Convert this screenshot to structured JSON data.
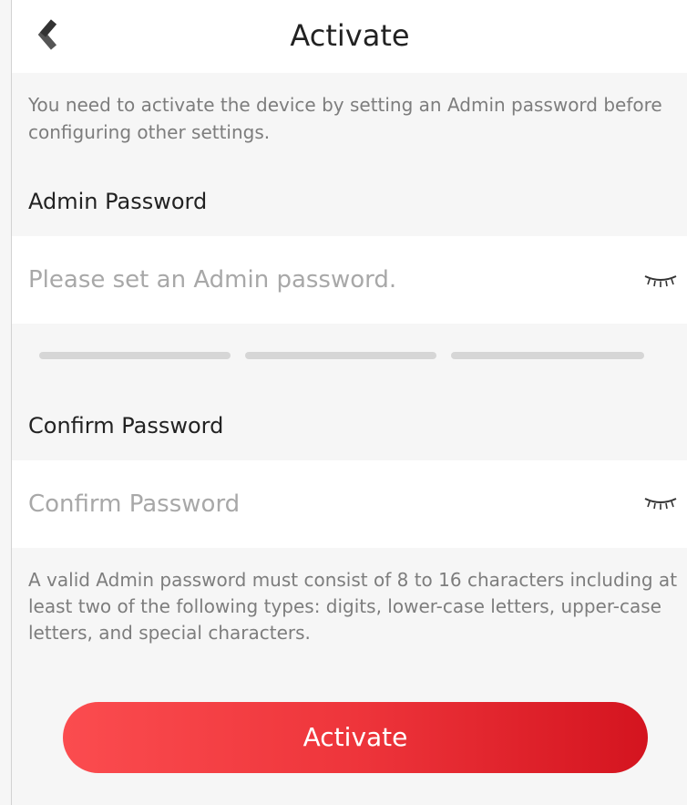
{
  "header": {
    "title": "Activate",
    "back_icon": "chevron-left-icon"
  },
  "intro_text": "You need to activate the device by setting an Admin password before configuring other settings.",
  "admin_password": {
    "label": "Admin Password",
    "value": "",
    "placeholder": "Please set an Admin password.",
    "visibility_icon": "eye-closed-icon"
  },
  "strength_meter": {
    "segments": 3,
    "filled": 0
  },
  "confirm_password": {
    "label": "Confirm Password",
    "value": "",
    "placeholder": "Confirm Password",
    "visibility_icon": "eye-closed-icon"
  },
  "hint_text": "A valid Admin password must consist of 8 to 16 characters including at least two of the following types: digits, lower-case letters, upper-case letters, and special characters.",
  "activate_button": {
    "label": "Activate"
  },
  "colors": {
    "accent_start": "#fb4c4f",
    "accent_end": "#d4141f",
    "background": "#f6f6f6",
    "strength_inactive": "#d6d6d6"
  }
}
